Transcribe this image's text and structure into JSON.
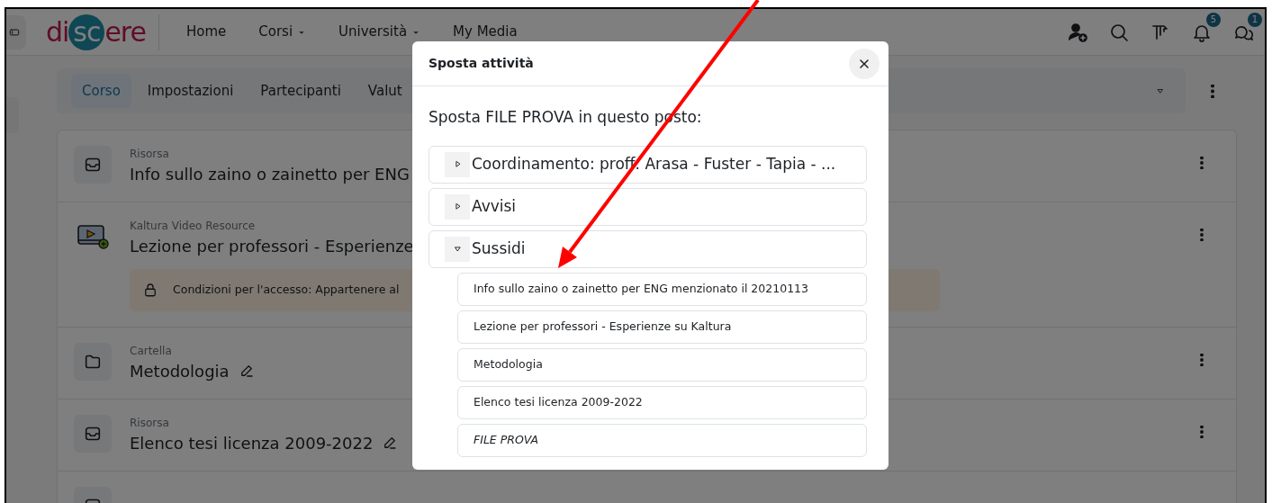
{
  "navbar": {
    "logo": {
      "prefix": "di",
      "highlight": "sc",
      "suffix": "ere"
    },
    "links": [
      {
        "label": "Home",
        "dropdown": false
      },
      {
        "label": "Corsi",
        "dropdown": true
      },
      {
        "label": "Università",
        "dropdown": true
      },
      {
        "label": "My Media",
        "dropdown": false
      }
    ],
    "notifications_badge": "5",
    "messages_badge": "1"
  },
  "course_nav": {
    "tabs": [
      {
        "label": "Corso",
        "selected": true
      },
      {
        "label": "Impostazioni",
        "selected": false
      },
      {
        "label": "Partecipanti",
        "selected": false
      },
      {
        "label": "Valut",
        "selected": false
      }
    ]
  },
  "activities": [
    {
      "kind": "file",
      "type": "Risorsa",
      "title": "Info sullo zaino o zainetto per ENG"
    },
    {
      "kind": "video",
      "type": "Kaltura Video Resource",
      "title": "Lezione per professori - Esperienze",
      "restriction": "Condizioni per l'accesso: Appartenere al"
    },
    {
      "kind": "folder",
      "type": "Cartella",
      "title": "Metodologia",
      "editable": true
    },
    {
      "kind": "file",
      "type": "Risorsa",
      "title": "Elenco tesi licenza 2009-2022",
      "editable": true
    },
    {
      "kind": "file"
    }
  ],
  "modal": {
    "title": "Sposta attività",
    "prompt": "Sposta FILE PROVA in questo posto:",
    "sections": [
      {
        "name": "Coordinamento: proff. Arasa - Fuster - Tapia - ...",
        "expanded": false
      },
      {
        "name": "Avvisi",
        "expanded": false
      },
      {
        "name": "Sussidi",
        "expanded": true,
        "children": [
          {
            "name": "Info sullo zaino o zainetto per ENG menzionato il 20210113",
            "moving": false
          },
          {
            "name": "Lezione per professori - Esperienze su Kaltura",
            "moving": false
          },
          {
            "name": "Metodologia",
            "moving": false
          },
          {
            "name": "Elenco tesi licenza 2009-2022",
            "moving": false
          },
          {
            "name": "FILE PROVA",
            "moving": true
          }
        ]
      }
    ]
  }
}
